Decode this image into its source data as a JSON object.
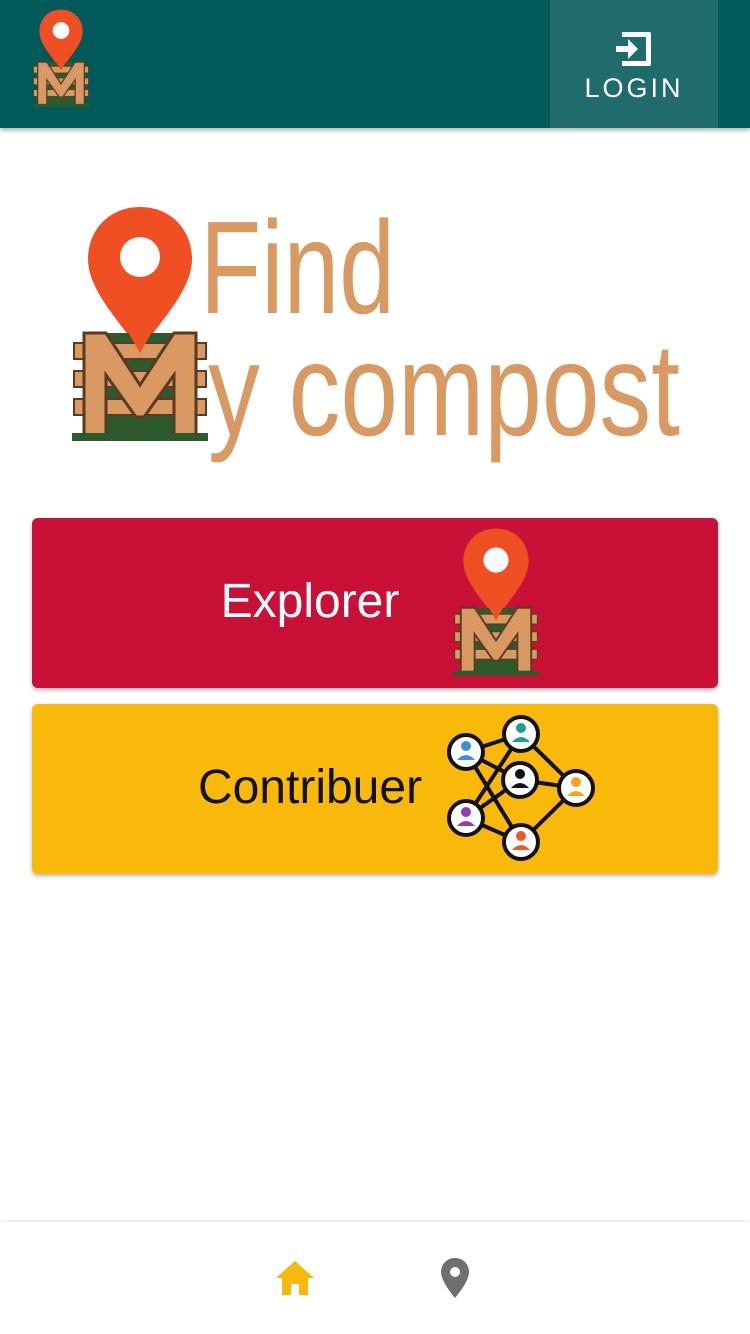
{
  "header": {
    "logo_icon": "compost-pin-logo-icon",
    "login_icon": "login-icon",
    "login_label": "LOGIN"
  },
  "hero": {
    "title_line1": "Find",
    "title_line2": "y compost",
    "logo_icon": "compost-bin-pin-icon"
  },
  "actions": {
    "explorer": {
      "label": "Explorer",
      "icon": "compost-pin-icon"
    },
    "contribuer": {
      "label": "Contribuer",
      "icon": "people-network-icon"
    }
  },
  "bottom_nav": {
    "items": [
      {
        "icon": "home-icon",
        "active": true
      },
      {
        "icon": "map-pin-icon",
        "active": false
      }
    ]
  },
  "colors": {
    "header": "#005a5a",
    "login_bg": "#206b6b",
    "explorer": "#c91037",
    "contribuer": "#f9b90b",
    "title": "#d89a62",
    "pin": "#f04e23",
    "nav_active": "#f9b90b",
    "nav_inactive": "#6f6f6f"
  }
}
